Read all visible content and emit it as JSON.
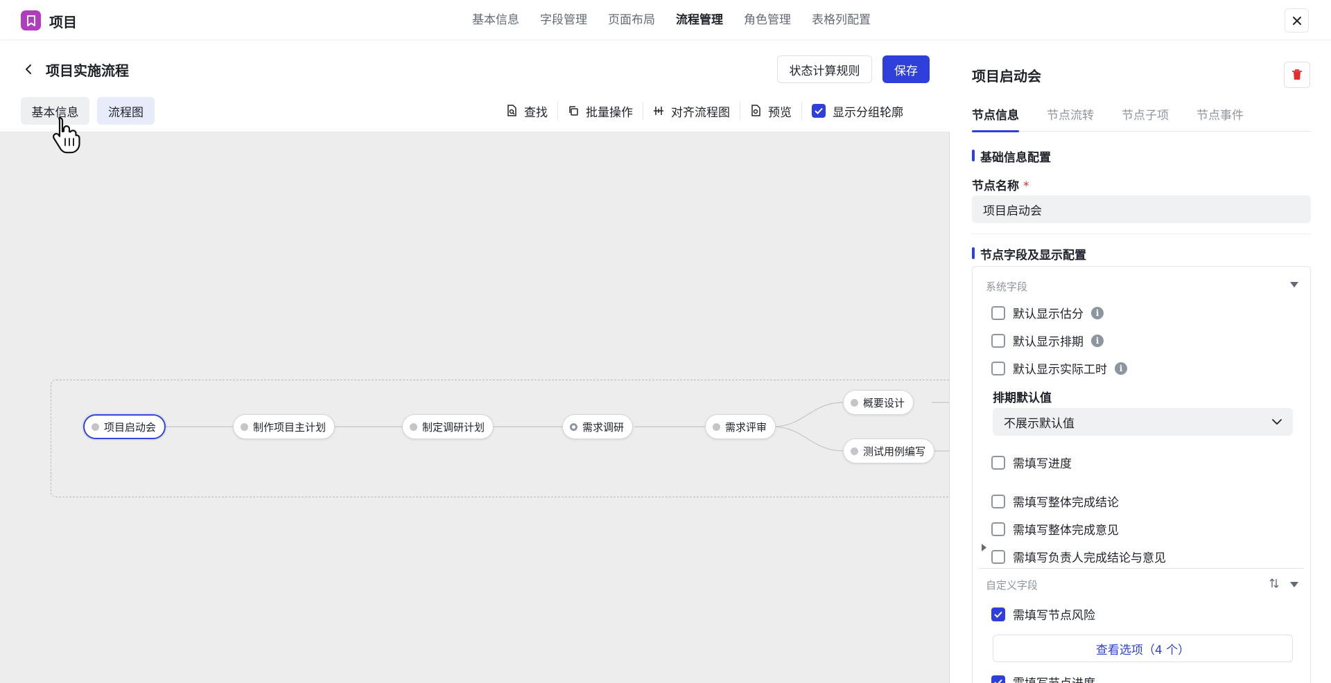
{
  "app": {
    "title": "项目",
    "logo_icon": "bookmark-icon",
    "logo_color": "#b13cc0"
  },
  "top_nav": [
    {
      "label": "基本信息",
      "active": false
    },
    {
      "label": "字段管理",
      "active": false
    },
    {
      "label": "页面布局",
      "active": false
    },
    {
      "label": "流程管理",
      "active": true
    },
    {
      "label": "角色管理",
      "active": false
    },
    {
      "label": "表格列配置",
      "active": false
    }
  ],
  "editor": {
    "title": "项目实施流程",
    "rules_button": "状态计算规则",
    "save_button": "保存",
    "mode_tabs": [
      "基本信息",
      "流程图"
    ],
    "toolbar": {
      "find": "查找",
      "batch": "批量操作",
      "align": "对齐流程图",
      "preview": "预览",
      "show_outline": "显示分组轮廓",
      "show_outline_checked": true
    }
  },
  "flow": {
    "nodes": [
      {
        "label": "项目启动会",
        "selected": true
      },
      {
        "label": "制作项目主计划"
      },
      {
        "label": "制定调研计划"
      },
      {
        "label": "需求调研",
        "ring": true
      },
      {
        "label": "需求评审"
      },
      {
        "label": "概要设计"
      },
      {
        "label": "测试用例编写"
      }
    ]
  },
  "panel": {
    "title": "项目启动会",
    "tabs": [
      "节点信息",
      "节点流转",
      "节点子项",
      "节点事件"
    ],
    "basic_section": "基础信息配置",
    "node_name_label": "节点名称",
    "required_mark": "*",
    "node_name_value": "项目启动会",
    "field_section": "节点字段及显示配置",
    "system_fields_label": "系统字段",
    "system_fields": [
      {
        "label": "默认显示估分",
        "checked": false,
        "info": true
      },
      {
        "label": "默认显示排期",
        "checked": false,
        "info": true
      },
      {
        "label": "默认显示实际工时",
        "checked": false,
        "info": true
      }
    ],
    "schedule_default_label": "排期默认值",
    "schedule_default_value": "不展示默认值",
    "progress_fields": [
      {
        "label": "需填写进度",
        "checked": false
      },
      {
        "label": "需填写整体完成结论",
        "checked": false
      },
      {
        "label": "需填写整体完成意见",
        "checked": false
      },
      {
        "label": "需填写负责人完成结论与意见",
        "checked": false
      }
    ],
    "custom_fields_label": "自定义字段",
    "custom_fields": [
      {
        "label": "需填写节点风险",
        "checked": true
      },
      {
        "label": "需填写节点进度",
        "checked": true
      }
    ],
    "view_options_button": "查看选项（4 个）"
  },
  "colors": {
    "primary": "#2f3fd9",
    "danger": "#e22d2d"
  }
}
